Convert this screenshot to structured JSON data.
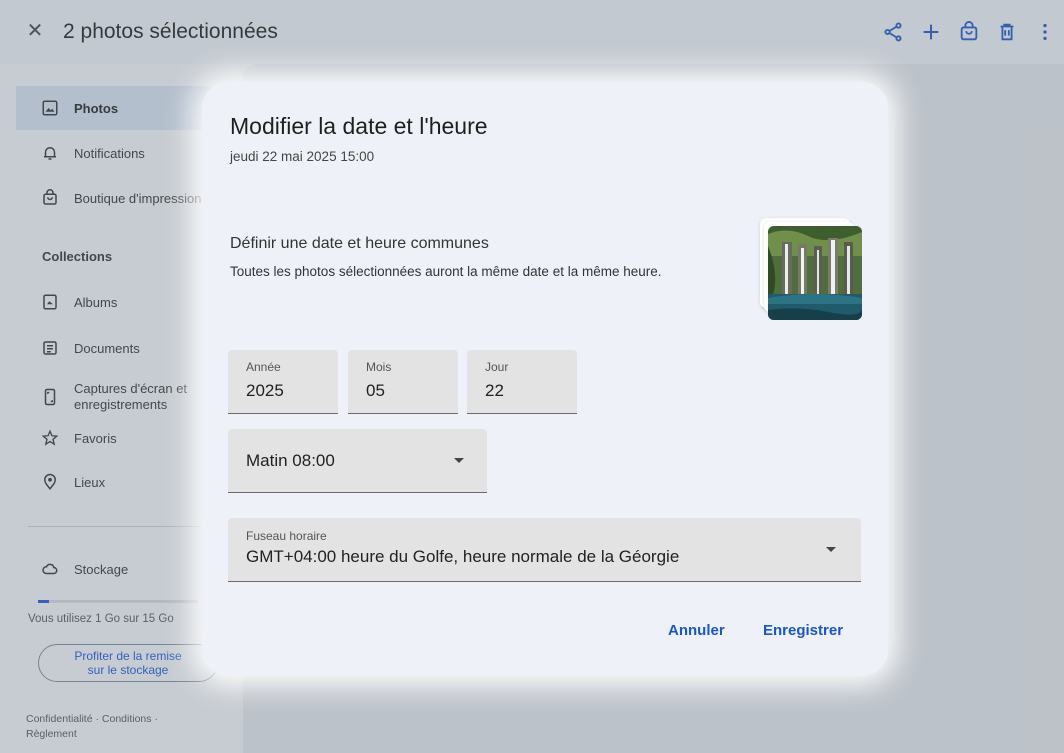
{
  "topbar": {
    "title": "2 photos sélectionnées",
    "actions": [
      "share-icon",
      "add-icon",
      "shopping-bag-icon",
      "delete-icon",
      "more-vert-icon"
    ]
  },
  "sidebar": {
    "items": [
      {
        "label": "Photos",
        "icon": "photo-icon",
        "active": true
      },
      {
        "label": "Notifications",
        "icon": "bell-icon"
      },
      {
        "label": "Boutique d'impression",
        "icon": "shopping-bag-icon"
      }
    ],
    "collections_title": "Collections",
    "collections": [
      {
        "label": "Albums",
        "icon": "album-icon"
      },
      {
        "label": "Documents",
        "icon": "document-icon"
      },
      {
        "label": "Captures d'écran et enregistrements",
        "icon": "phone-screenshot-icon"
      },
      {
        "label": "Favoris",
        "icon": "star-icon"
      },
      {
        "label": "Lieux",
        "icon": "location-pin-icon"
      }
    ],
    "storage": {
      "label": "Stockage",
      "icon": "cloud-icon",
      "usage_text": "Vous utilisez 1 Go sur 15 Go",
      "used_fraction": 0.0667,
      "promo_line1": "Profiter de la remise",
      "promo_line2": "sur le stockage"
    },
    "footer": {
      "confidentiality": "Confidentialité",
      "sep1": "·",
      "conditions": "Conditions",
      "sep2": "·",
      "rules": "Règlement"
    }
  },
  "dialog": {
    "title": "Modifier la date et l'heure",
    "subtitle": "jeudi 22 mai 2025 15:00",
    "section_title": "Définir une date et heure communes",
    "section_desc": "Toutes les photos sélectionnées auront la même date et la même heure.",
    "year": {
      "label": "Année",
      "value": "2025"
    },
    "month": {
      "label": "Mois",
      "value": "05"
    },
    "day": {
      "label": "Jour",
      "value": "22"
    },
    "time": {
      "value": "Matin 08:00"
    },
    "timezone": {
      "label": "Fuseau horaire",
      "value": "GMT+04:00 heure du Golfe, heure normale de la Géorgie"
    },
    "cancel": "Annuler",
    "save": "Enregistrer"
  },
  "colors": {
    "accent": "#1a56c8",
    "dialog_bg": "#eef2f8",
    "field_bg": "#e3e3e3"
  }
}
